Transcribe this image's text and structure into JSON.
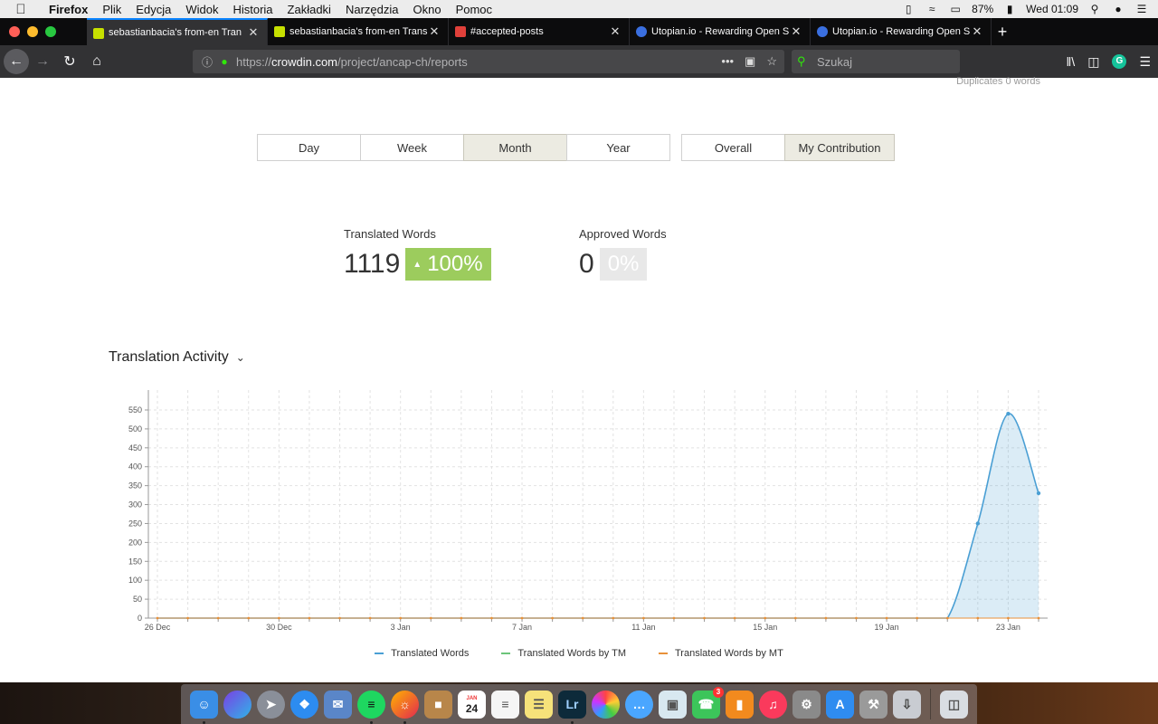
{
  "menubar": {
    "app": "Firefox",
    "items": [
      "Plik",
      "Edycja",
      "Widok",
      "Historia",
      "Zakładki",
      "Narzędzia",
      "Okno",
      "Pomoc"
    ],
    "battery": "87%",
    "clock": "Wed 01:09"
  },
  "tabs": [
    {
      "title": "sebastianbacia's from-en Tran",
      "active": true
    },
    {
      "title": "sebastianbacia's from-en Trans",
      "active": false
    },
    {
      "title": "#accepted-posts",
      "active": false
    },
    {
      "title": "Utopian.io - Rewarding Open S",
      "active": false
    },
    {
      "title": "Utopian.io - Rewarding Open S",
      "active": false
    }
  ],
  "urlbar": {
    "prefix": "https://",
    "domain": "crowdin.com",
    "path": "/project/ancap-ch/reports"
  },
  "search": {
    "placeholder": "Szukaj"
  },
  "page": {
    "duplicates": "Duplicates 0 words",
    "period_buttons": [
      {
        "label": "Day",
        "active": false
      },
      {
        "label": "Week",
        "active": false
      },
      {
        "label": "Month",
        "active": true
      },
      {
        "label": "Year",
        "active": false
      }
    ],
    "scope_buttons": [
      {
        "label": "Overall",
        "active": false
      },
      {
        "label": "My Contribution",
        "active": true
      }
    ],
    "translated": {
      "label": "Translated Words",
      "value": "1119",
      "change": "100%"
    },
    "approved": {
      "label": "Approved Words",
      "value": "0",
      "change": "0%"
    },
    "activity_title": "Translation Activity"
  },
  "chart_data": {
    "type": "area",
    "x_tick_labels": [
      "26 Dec",
      "30 Dec",
      "3 Jan",
      "7 Jan",
      "11 Jan",
      "15 Jan",
      "19 Jan",
      "23 Jan"
    ],
    "x": [
      "26 Dec",
      "27 Dec",
      "28 Dec",
      "29 Dec",
      "30 Dec",
      "31 Dec",
      "1 Jan",
      "2 Jan",
      "3 Jan",
      "4 Jan",
      "5 Jan",
      "6 Jan",
      "7 Jan",
      "8 Jan",
      "9 Jan",
      "10 Jan",
      "11 Jan",
      "12 Jan",
      "13 Jan",
      "14 Jan",
      "15 Jan",
      "16 Jan",
      "17 Jan",
      "18 Jan",
      "19 Jan",
      "20 Jan",
      "21 Jan",
      "22 Jan",
      "23 Jan",
      "24 Jan"
    ],
    "y_ticks": [
      0,
      50,
      100,
      150,
      200,
      250,
      300,
      350,
      400,
      450,
      500,
      550
    ],
    "ylim": [
      0,
      550
    ],
    "grid": true,
    "series": [
      {
        "name": "Translated Words",
        "color": "#4a9fd4",
        "values": [
          0,
          0,
          0,
          0,
          0,
          0,
          0,
          0,
          0,
          0,
          0,
          0,
          0,
          0,
          0,
          0,
          0,
          0,
          0,
          0,
          0,
          0,
          0,
          0,
          0,
          0,
          0,
          250,
          540,
          330
        ]
      },
      {
        "name": "Translated Words by TM",
        "color": "#6cc47a",
        "values": [
          0,
          0,
          0,
          0,
          0,
          0,
          0,
          0,
          0,
          0,
          0,
          0,
          0,
          0,
          0,
          0,
          0,
          0,
          0,
          0,
          0,
          0,
          0,
          0,
          0,
          0,
          0,
          0,
          0,
          0
        ]
      },
      {
        "name": "Translated Words by MT",
        "color": "#e8913a",
        "values": [
          0,
          0,
          0,
          0,
          0,
          0,
          0,
          0,
          0,
          0,
          0,
          0,
          0,
          0,
          0,
          0,
          0,
          0,
          0,
          0,
          0,
          0,
          0,
          0,
          0,
          0,
          0,
          0,
          0,
          0
        ]
      }
    ]
  },
  "dock": {
    "calendar_month": "JAN",
    "calendar_day": "24",
    "facetime_badge": "3"
  }
}
